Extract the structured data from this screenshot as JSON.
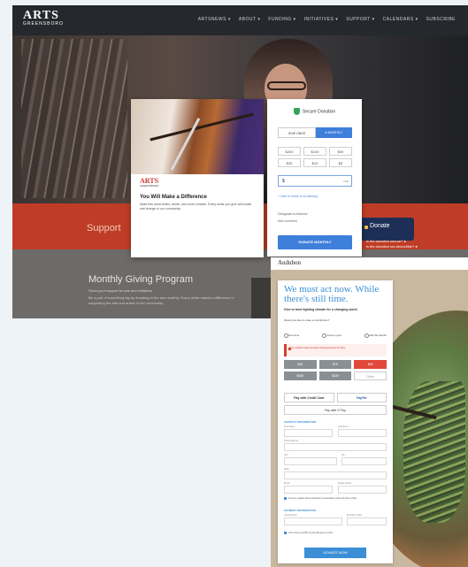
{
  "arts_site": {
    "logo_main": "ARTS",
    "logo_sub": "GREENSBORO",
    "nav": [
      "ARTSNEWS ▾",
      "ABOUT ▾",
      "FUNDING ▾",
      "INITIATIVES ▾",
      "SUPPORT ▾",
      "CALENDARS ▾",
      "SUBSCRIBE"
    ],
    "support_text": "Support",
    "donate_tab": "Donate",
    "side_lines": [
      "is the donation secure? ●",
      "is the donation tax-deductible? ●",
      "can i cancel my recurring donation? ●"
    ],
    "monthly_title": "Monthly Giving Program",
    "monthly_sub": "Show your support for arts and initiatives",
    "monthly_para": "Be a part of something big by donating to the arts monthly. Every dollar makes a difference in supporting the arts and artists in our community."
  },
  "popup": {
    "logo_main": "ARTS",
    "logo_sub": "GREENSBORO",
    "heading": "You Will Make a Difference",
    "body": "Make this world better, kinder, and more creative. Every dollar you give will create real change in our community."
  },
  "donation_form": {
    "title": "Secure Donation",
    "give_once": "GIVE ONCE",
    "monthly": "♥ MONTHLY",
    "amounts": [
      "$250",
      "$100",
      "$50",
      "$30",
      "$10",
      "$5"
    ],
    "currency_symbol": "$",
    "currency": "USD",
    "honor_link": "+ Give in honor or in memory",
    "designation": "Designate to Artsfund",
    "comment": "Add comment",
    "submit": "DONATE MONTHLY"
  },
  "audubon": {
    "brand": "Audubon",
    "heading": "We must act now. While there's still time.",
    "subheading": "Give to fund fighting climate for a changing world",
    "question": "Would you like to make a contribution?",
    "frequency": [
      "One-time",
      "Once a year",
      "Add this Month"
    ],
    "alert": "Your monthly support provides lasting protection for birds.",
    "amounts": [
      "$35",
      "$75",
      "$25",
      "$500",
      "$150"
    ],
    "other_placeholder": "Other",
    "pay_card": "Pay with Credit Card",
    "pay_paypal": "PayPal",
    "pay_google": "Pay with G Pay",
    "section_personal": "CONTACT INFORMATION",
    "first_name": "First Name",
    "last_name": "Last Name",
    "address": "Street Address",
    "city": "City",
    "zip": "Zip",
    "state": "State",
    "email": "Email",
    "phone": "Mobile Phone",
    "opt_in": "Text me updates about Audubon's conservation work and how to help",
    "section_payment": "PAYMENT INFORMATION",
    "card_number": "Card Number",
    "expiration": "Expiration Date",
    "cover_fees": "Cover fees so 100% of your gift goes to birds",
    "submit": "DONATE NOW",
    "footer_note": "Your tax-deductible contribution supports Audubon's mission to protect birds and the places they need."
  }
}
